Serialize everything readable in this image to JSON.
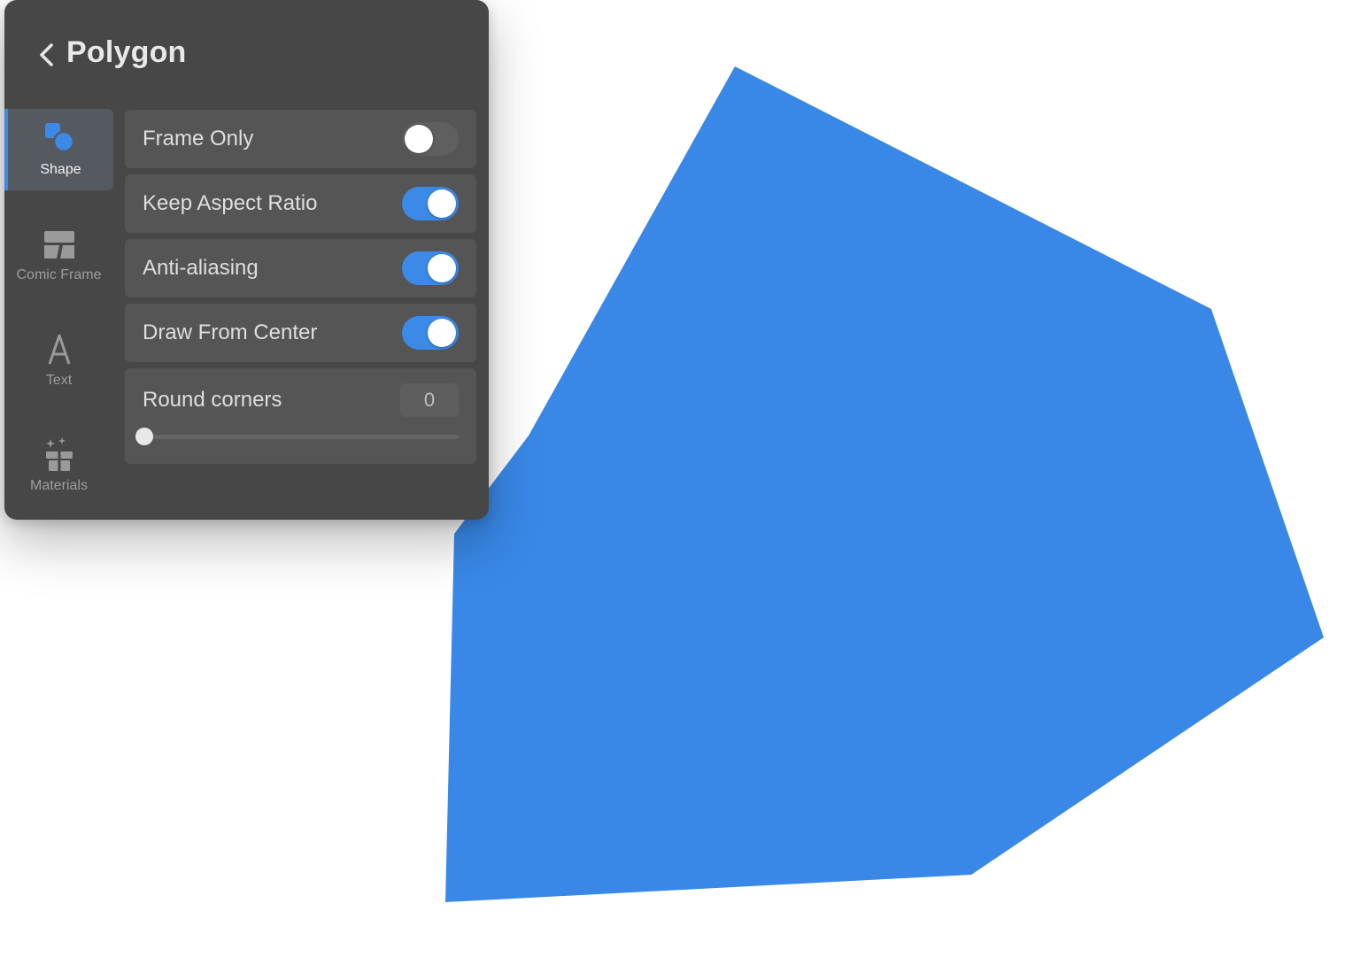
{
  "canvas": {
    "shape_color": "#3988E7",
    "background": "#FFFFFF"
  },
  "panel": {
    "title": "Polygon",
    "back_icon": "chevron-left-icon",
    "sidebar": {
      "items": [
        {
          "label": "Shape",
          "icon": "shape-icon",
          "active": true
        },
        {
          "label": "Comic Frame",
          "icon": "comic-frame-icon",
          "active": false
        },
        {
          "label": "Text",
          "icon": "text-icon",
          "active": false
        },
        {
          "label": "Materials",
          "icon": "materials-icon",
          "active": false
        }
      ]
    },
    "settings": {
      "frame_only": {
        "label": "Frame Only",
        "on": false
      },
      "keep_aspect_ratio": {
        "label": "Keep Aspect Ratio",
        "on": true
      },
      "anti_aliasing": {
        "label": "Anti-aliasing",
        "on": true
      },
      "draw_from_center": {
        "label": "Draw From Center",
        "on": true
      },
      "round_corners": {
        "label": "Round corners",
        "value": "0",
        "slider_fraction": 0
      }
    },
    "accent_color": "#3B8AE8"
  }
}
